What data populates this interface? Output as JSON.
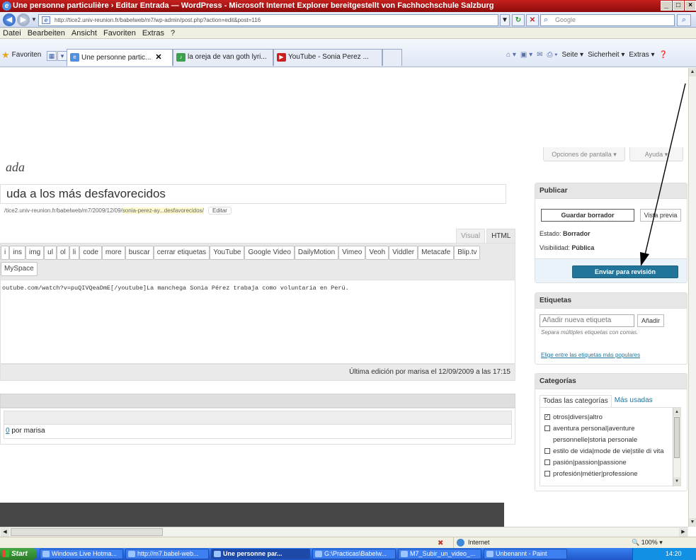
{
  "window": {
    "title": "Une personne particulière › Editar Entrada — WordPress - Microsoft Internet Explorer bereitgestellt von Fachhochschule Salzburg"
  },
  "address": {
    "url": "http://tice2.univ-reunion.fr/babelweb/m7/wp-admin/post.php?action=edit&post=116",
    "search_placeholder": "Google"
  },
  "menu": [
    "Datei",
    "Bearbeiten",
    "Ansicht",
    "Favoriten",
    "Extras",
    "?"
  ],
  "favorites_label": "Favoriten",
  "tabs": [
    {
      "label": "Une personne partic...",
      "active": true
    },
    {
      "label": "la oreja de van goth lyri...",
      "active": false
    },
    {
      "label": "YouTube - Sonia Perez ...",
      "active": false
    }
  ],
  "cmd_tools": [
    "Seite",
    "Sicherheit",
    "Extras"
  ],
  "wp": {
    "screen_options": "Opciones de pantalla",
    "help": "Ayuda",
    "heading_fragment": "ada",
    "post_title": "uda a los más desfavorecidos",
    "permalink_prefix": "/tice2.univ-reunion.fr/babelweb/m7/2009/12/09/",
    "permalink_slug": "sonia-perez-ay...desfavorecidos/",
    "edit_label": "Editar",
    "editor_tabs": [
      "Visual",
      "HTML"
    ],
    "quicktags_row1": [
      "i",
      "ins",
      "img",
      "ul",
      "ol",
      "li",
      "code",
      "more",
      "buscar",
      "cerrar etiquetas",
      "YouTube",
      "Google Video",
      "DailyMotion",
      "Vimeo",
      "Veoh",
      "Viddler",
      "Metacafe",
      "Blip.tv"
    ],
    "quicktags_row2": [
      "MySpace"
    ],
    "content": "outube.com/watch?v=puQIVQeaDmE[/youtube]La manchega Sonia Pérez trabaja como voluntaria en Perú.",
    "last_edit": "Última edición por marisa el 12/09/2009 a las 17:15",
    "revision_head": "",
    "revision_row": "por marisa"
  },
  "publish": {
    "title": "Publicar",
    "save_draft": "Guardar borrador",
    "preview": "Vista previa",
    "status_label": "Estado:",
    "status_value": "Borrador",
    "visibility_label": "Visibilidad:",
    "visibility_value": "Pública",
    "submit": "Enviar para revisión"
  },
  "tags": {
    "title": "Etiquetas",
    "placeholder": "Añadir nueva etiqueta",
    "add": "Añadir",
    "hint": "Separa múltiples etiquetas con comas.",
    "popular": "Elige entre las etiquetas más populares"
  },
  "categories": {
    "title": "Categorías",
    "tab_all": "Todas las categorías",
    "tab_used": "Más usadas",
    "items": [
      {
        "label": "otros|divers|altro",
        "checked": true
      },
      {
        "label": "aventura personal|aventure personnelle|storia personale",
        "checked": false
      },
      {
        "label": "estilo de vida|mode de vie|stile di vita",
        "checked": false
      },
      {
        "label": "pasión|passion|passione",
        "checked": false
      },
      {
        "label": "profesión|métier|professione",
        "checked": false
      }
    ]
  },
  "statusbar": {
    "zone": "Internet",
    "zoom": "100%"
  },
  "taskbar": {
    "start": "Start",
    "items": [
      {
        "label": "Windows Live Hotma...",
        "active": false
      },
      {
        "label": "http://m7.babel-web...",
        "active": false
      },
      {
        "label": "Une personne par...",
        "active": true
      },
      {
        "label": "G:\\Practicas\\Babelw...",
        "active": false
      },
      {
        "label": "M7_Subir_un_video_...",
        "active": false
      },
      {
        "label": "Unbenannt - Paint",
        "active": false
      }
    ],
    "clock": "14:20"
  },
  "colors": {
    "title_bar": "#a0120f",
    "wp_primary_button": "#21759b",
    "annotation_arrow": "#000000"
  }
}
